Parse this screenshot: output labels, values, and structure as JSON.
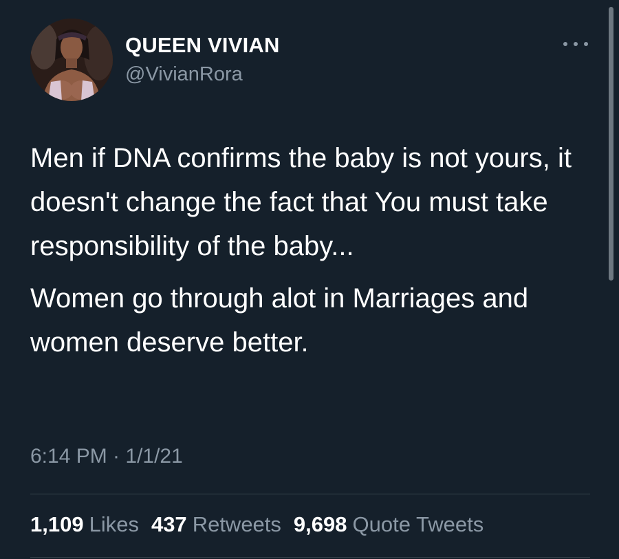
{
  "tweet": {
    "display_name": "QUEEN VIVIAN",
    "handle": "@VivianRora",
    "paragraphs": [
      "Men if DNA confirms the baby is not yours, it doesn't change the fact that You must take responsibility of the baby...",
      "Women go through alot in Marriages and women deserve better."
    ],
    "timestamp": "6:14 PM · 1/1/21",
    "stats": {
      "likes": {
        "count": "1,109",
        "label": "Likes"
      },
      "retweets": {
        "count": "437",
        "label": "Retweets"
      },
      "quotes": {
        "count": "9,698",
        "label": "Quote Tweets"
      }
    }
  },
  "icons": {
    "more": "more-horizontal-icon"
  },
  "colors": {
    "background": "#15202b",
    "primary_text": "#ffffff",
    "secondary_text": "#8b98a5",
    "divider": "#38444d"
  }
}
